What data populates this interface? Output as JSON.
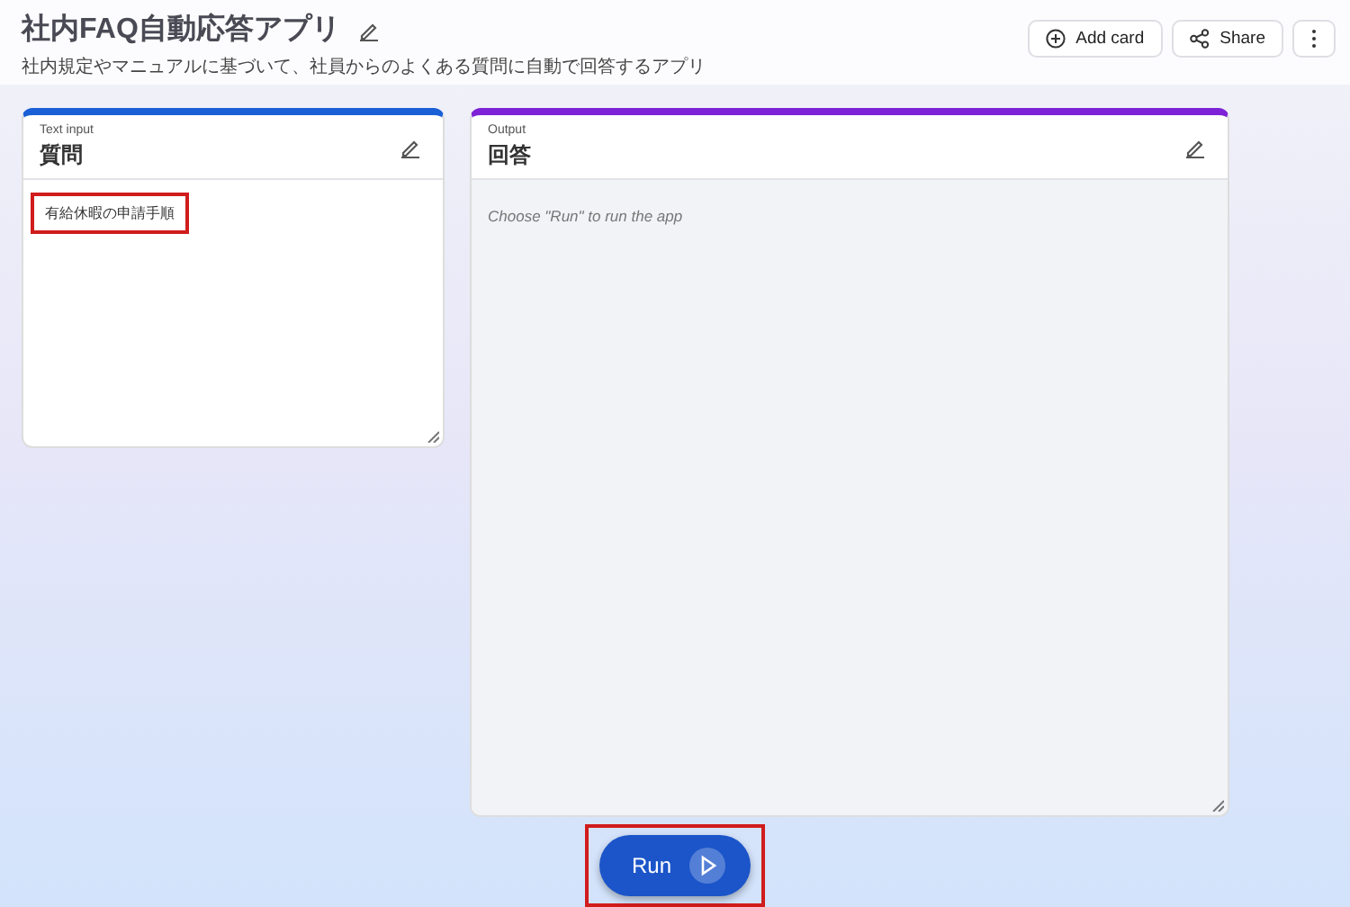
{
  "app": {
    "title": "社内FAQ自動応答アプリ",
    "description": "社内規定やマニュアルに基づいて、社員からのよくある質問に自動で回答するアプリ"
  },
  "toolbar": [
    {
      "kind": "add",
      "label": "Add card"
    },
    {
      "kind": "share",
      "label": "Share"
    },
    {
      "kind": "more"
    }
  ],
  "cards": [
    {
      "kind": "input",
      "type_label": "Text input",
      "title": "質問",
      "value": "有給休暇の申請手順",
      "highlighted": true,
      "color": "#1a5fd6"
    },
    {
      "kind": "output",
      "type_label": "Output",
      "title": "回答",
      "placeholder": "Choose \"Run\" to run the app",
      "color": "#7d22d6"
    }
  ],
  "run_button": {
    "label": "Run",
    "highlighted": true
  }
}
